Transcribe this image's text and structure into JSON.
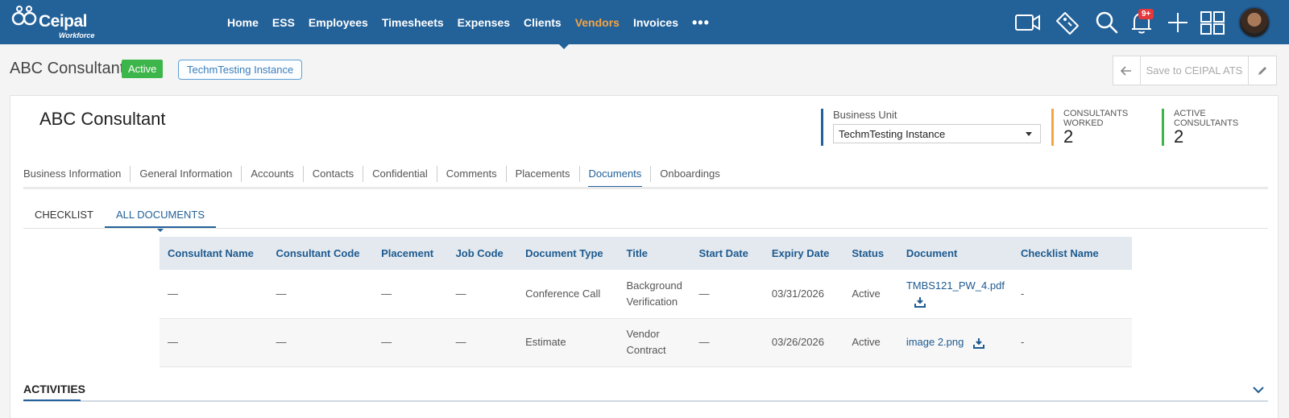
{
  "app": {
    "logo_text": "Ceipal",
    "logo_sub": "Workforce",
    "notification_count": "9+",
    "nav": [
      {
        "label": "Home",
        "active": false
      },
      {
        "label": "ESS",
        "active": false
      },
      {
        "label": "Employees",
        "active": false
      },
      {
        "label": "Timesheets",
        "active": false
      },
      {
        "label": "Expenses",
        "active": false
      },
      {
        "label": "Clients",
        "active": false
      },
      {
        "label": "Vendors",
        "active": true
      },
      {
        "label": "Invoices",
        "active": false
      }
    ],
    "nav_more": "•••",
    "icons": [
      "video-icon",
      "tag-icon",
      "search-icon",
      "bell-icon",
      "plus-icon",
      "grid-icon",
      "avatar"
    ]
  },
  "header": {
    "title": "ABC Consultant",
    "status": "Active",
    "instance": "TechmTesting Instance",
    "save_label": "Save to CEIPAL ATS"
  },
  "card": {
    "title": "ABC Consultant",
    "business_unit_label": "Business Unit",
    "business_unit_value": "TechmTesting Instance",
    "stats": [
      {
        "label": "CONSULTANTS WORKED",
        "value": "2",
        "color": "#f5a443"
      },
      {
        "label": "ACTIVE CONSULTANTS",
        "value": "2",
        "color": "#3cb54a"
      }
    ]
  },
  "tabs": [
    {
      "label": "Business Information",
      "active": false
    },
    {
      "label": "General Information",
      "active": false
    },
    {
      "label": "Accounts",
      "active": false
    },
    {
      "label": "Contacts",
      "active": false
    },
    {
      "label": "Confidential",
      "active": false
    },
    {
      "label": "Comments",
      "active": false
    },
    {
      "label": "Placements",
      "active": false
    },
    {
      "label": "Documents",
      "active": true
    },
    {
      "label": "Onboardings",
      "active": false
    }
  ],
  "subtabs": [
    {
      "label": "CHECKLIST",
      "active": false
    },
    {
      "label": "ALL DOCUMENTS",
      "active": true
    }
  ],
  "table": {
    "columns": [
      "Consultant Name",
      "Consultant Code",
      "Placement",
      "Job Code",
      "Document Type",
      "Title",
      "Start Date",
      "Expiry Date",
      "Status",
      "Document",
      "Checklist Name"
    ],
    "rows": [
      {
        "consultant_name": "—",
        "consultant_code": "—",
        "placement": "—",
        "job_code": "—",
        "document_type": "Conference Call",
        "title": "Background Verification",
        "start_date": "—",
        "expiry_date": "03/31/2026",
        "status": "Active",
        "document": "TMBS121_PW_4.pdf",
        "checklist_name": "-"
      },
      {
        "consultant_name": "—",
        "consultant_code": "—",
        "placement": "—",
        "job_code": "—",
        "document_type": "Estimate",
        "title": "Vendor Contract",
        "start_date": "—",
        "expiry_date": "03/26/2026",
        "status": "Active",
        "document": "image 2.png",
        "checklist_name": "-"
      }
    ]
  },
  "activities": {
    "label": "ACTIVITIES"
  },
  "colors": {
    "brand": "#236199",
    "accent": "#f5a443",
    "active": "#3cb54a"
  }
}
